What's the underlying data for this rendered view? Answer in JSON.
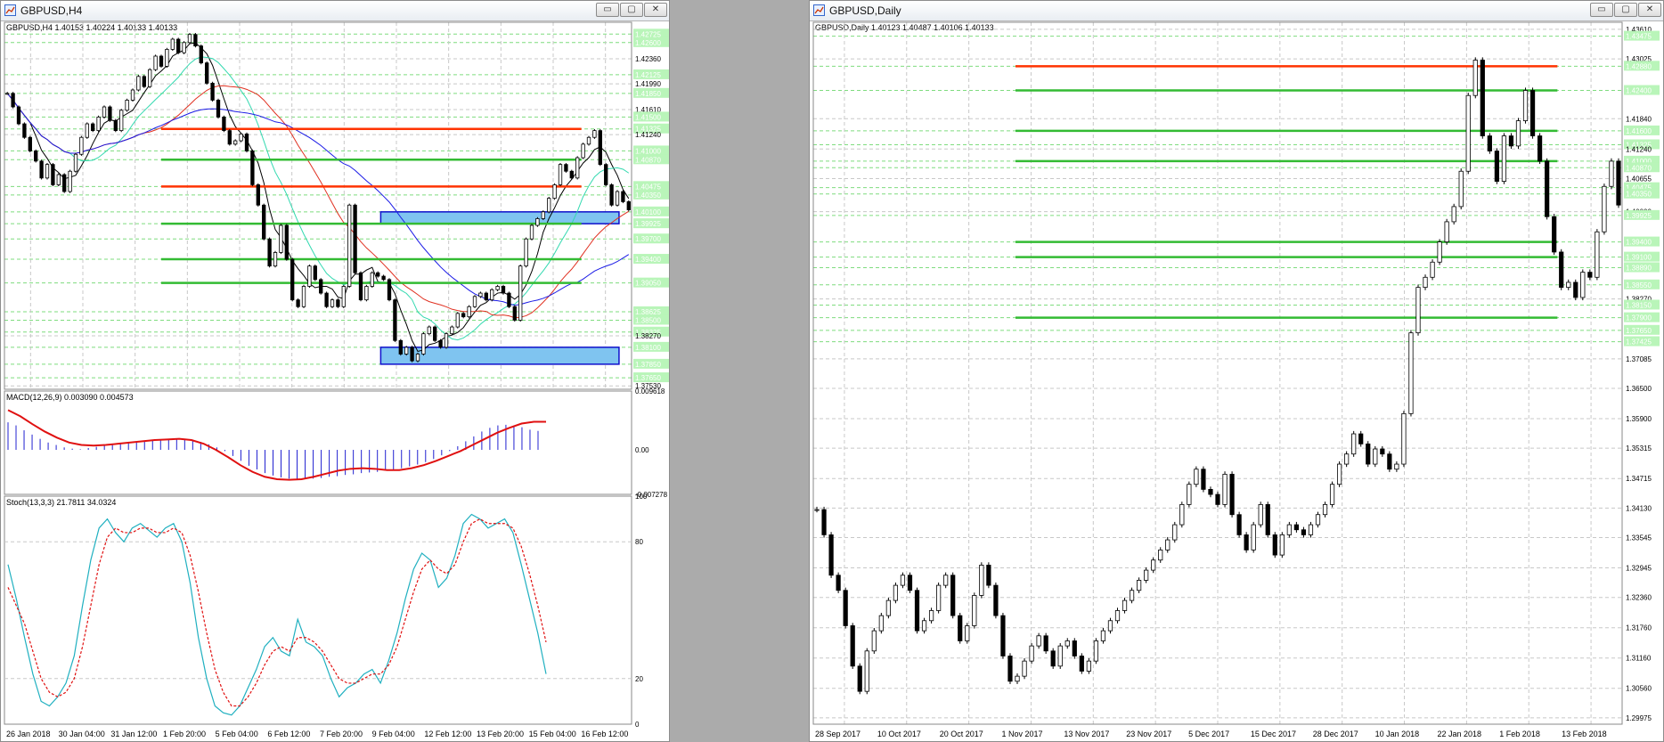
{
  "colors": {
    "grid": "#c8c8c8",
    "bull_candle": "#000000",
    "bear_candle": "#000000",
    "level_band_green": "#b9f5b9",
    "resistance_line": "#ff3300",
    "support_line": "#33bb33",
    "zone_fill": "#7fc4f0",
    "zone_border": "#1010cc",
    "ma_red": "#e03020",
    "ma_blue": "#1a1ae6",
    "ma_cyan": "#33d9b0",
    "ma_black": "#000000",
    "macd_hist": "#2020d0",
    "macd_signal": "#e01010",
    "stoch_main": "#20b0c0",
    "stoch_signal": "#e01010"
  },
  "windows": [
    {
      "title": "GBPUSD,H4",
      "icon": "chart-window-icon",
      "buttons": [
        "minimize",
        "maximize",
        "close"
      ]
    },
    {
      "title": "GBPUSD,Daily",
      "icon": "chart-window-icon",
      "buttons": [
        "minimize",
        "maximize",
        "close"
      ]
    }
  ],
  "chart_data": [
    {
      "type": "candlestick",
      "symbol_header": "GBPUSD,H4  1.40153 1.40224 1.40133 1.40133",
      "price_ticks": [
        "1.42725",
        "1.42600",
        "1.42360",
        "1.42125",
        "1.41990",
        "1.41850",
        "1.41610",
        "1.41500",
        "1.41325",
        "1.41240",
        "1.41000",
        "1.40870",
        "1.40475",
        "1.40350",
        "1.40100",
        "1.39925",
        "1.39700",
        "1.39400",
        "1.39050",
        "1.38625",
        "1.38500",
        "1.38325",
        "1.38270",
        "1.38100",
        "1.37850",
        "1.37650",
        "1.37530"
      ],
      "highlighted_ticks": [
        "1.42725",
        "1.42600",
        "1.42125",
        "1.41850",
        "1.41500",
        "1.41325",
        "1.41000",
        "1.40870",
        "1.40475",
        "1.40350",
        "1.40100",
        "1.39925",
        "1.39700",
        "1.39400",
        "1.39050",
        "1.38625",
        "1.38500",
        "1.38325",
        "1.38100",
        "1.37850",
        "1.37650"
      ],
      "ylim": [
        1.3748,
        1.429
      ],
      "x_labels": [
        "26 Jan 2018",
        "30 Jan 04:00",
        "31 Jan 12:00",
        "1 Feb 20:00",
        "5 Feb 04:00",
        "6 Feb 12:00",
        "7 Feb 20:00",
        "9 Feb 04:00",
        "12 Feb 12:00",
        "13 Feb 20:00",
        "15 Feb 04:00",
        "16 Feb 12:00"
      ],
      "candles_close": [
        1.4185,
        1.4165,
        1.414,
        1.412,
        1.41,
        1.4085,
        1.406,
        1.408,
        1.405,
        1.4065,
        1.404,
        1.407,
        1.4095,
        1.412,
        1.414,
        1.413,
        1.415,
        1.4165,
        1.4145,
        1.413,
        1.416,
        1.4175,
        1.419,
        1.421,
        1.4195,
        1.422,
        1.424,
        1.4225,
        1.425,
        1.4265,
        1.4245,
        1.426,
        1.4272,
        1.4255,
        1.423,
        1.42,
        1.4175,
        1.415,
        1.413,
        1.411,
        1.4115,
        1.4125,
        1.41,
        1.405,
        1.402,
        1.397,
        1.393,
        1.395,
        1.399,
        1.394,
        1.388,
        1.387,
        1.39,
        1.393,
        1.391,
        1.389,
        1.387,
        1.388,
        1.387,
        1.39,
        1.402,
        1.392,
        1.388,
        1.39,
        1.392,
        1.3915,
        1.391,
        1.388,
        1.382,
        1.38,
        1.381,
        1.379,
        1.38,
        1.383,
        1.384,
        1.382,
        1.381,
        1.383,
        1.384,
        1.386,
        1.3855,
        1.387,
        1.3885,
        1.389,
        1.388,
        1.3895,
        1.39,
        1.389,
        1.387,
        1.385,
        1.393,
        1.397,
        1.399,
        1.4,
        1.401,
        1.403,
        1.405,
        1.408,
        1.407,
        1.406,
        1.409,
        1.411,
        1.412,
        1.413,
        1.408,
        1.405,
        1.402,
        1.404,
        1.4025,
        1.4013
      ],
      "horizontal_levels": [
        {
          "price": 1.41325,
          "color": "resistance",
          "label": ""
        },
        {
          "price": 1.4087,
          "color": "support",
          "label": ""
        },
        {
          "price": 1.40475,
          "color": "resistance",
          "label": ""
        },
        {
          "price": 1.39925,
          "color": "support",
          "label": ""
        },
        {
          "price": 1.394,
          "color": "support",
          "label": ""
        },
        {
          "price": 1.3905,
          "color": "support",
          "label": ""
        }
      ],
      "zones": [
        {
          "from": 1.39925,
          "to": 1.401
        },
        {
          "from": 1.3785,
          "to": 1.381
        }
      ],
      "indicators": [
        {
          "type": "macd",
          "label": "MACD(12,26,9) 0.003090 0.004573",
          "ticks": [
            "0.009618",
            "0.00",
            "-0.007278"
          ],
          "ylim": [
            -0.007278,
            0.009618
          ],
          "histogram": [
            0.0045,
            0.004,
            0.0032,
            0.0025,
            0.0018,
            0.0012,
            0.0008,
            0.0004,
            0.0002,
            0.0001,
            0.0003,
            0.0005,
            0.0007,
            0.0009,
            0.0011,
            0.0013,
            0.0014,
            0.0015,
            0.0016,
            0.0017,
            0.0018,
            0.0019,
            0.0018,
            0.0016,
            0.0013,
            0.0009,
            0.0004,
            -0.0002,
            -0.001,
            -0.0018,
            -0.0026,
            -0.0032,
            -0.0038,
            -0.0042,
            -0.0045,
            -0.0047,
            -0.0048,
            -0.0048,
            -0.0047,
            -0.0046,
            -0.0044,
            -0.0043,
            -0.0041,
            -0.004,
            -0.0038,
            -0.0037,
            -0.0036,
            -0.0034,
            -0.0032,
            -0.003,
            -0.0027,
            -0.0024,
            -0.002,
            -0.0015,
            -0.0009,
            -0.0002,
            0.0006,
            0.0014,
            0.0022,
            0.003,
            0.0036,
            0.004,
            0.0041,
            0.004,
            0.0037,
            0.0033,
            0.0031
          ],
          "signal": [
            0.0065,
            0.0055,
            0.0042,
            0.003,
            0.002,
            0.0012,
            0.0008,
            0.0007,
            0.0008,
            0.001,
            0.0012,
            0.0014,
            0.0016,
            0.0017,
            0.0018,
            0.0016,
            0.001,
            0.0,
            -0.0012,
            -0.0025,
            -0.0036,
            -0.0044,
            -0.0048,
            -0.0049,
            -0.0048,
            -0.0044,
            -0.0039,
            -0.0034,
            -0.0031,
            -0.003,
            -0.0031,
            -0.0033,
            -0.0033,
            -0.003,
            -0.0025,
            -0.0018,
            -0.001,
            -0.0002,
            0.0008,
            0.0018,
            0.0028,
            0.0036,
            0.0043,
            0.0046,
            0.0046
          ]
        },
        {
          "type": "stochastic",
          "label": "Stoch(13,3,3) 21.7811 34.0324",
          "ticks": [
            "100",
            "80",
            "20",
            "0"
          ],
          "ylim": [
            0,
            100
          ],
          "main": [
            70,
            55,
            38,
            22,
            10,
            8,
            12,
            18,
            30,
            52,
            72,
            86,
            90,
            84,
            80,
            86,
            88,
            85,
            82,
            86,
            88,
            80,
            62,
            38,
            20,
            8,
            5,
            4,
            8,
            16,
            24,
            34,
            38,
            32,
            30,
            46,
            36,
            34,
            30,
            20,
            12,
            16,
            18,
            22,
            24,
            18,
            28,
            40,
            55,
            68,
            75,
            72,
            60,
            64,
            74,
            88,
            92,
            90,
            86,
            88,
            90,
            84,
            70,
            55,
            40,
            22
          ],
          "signal": [
            60,
            52,
            44,
            32,
            20,
            14,
            12,
            14,
            20,
            34,
            52,
            70,
            82,
            86,
            84,
            84,
            86,
            86,
            84,
            84,
            86,
            84,
            74,
            58,
            40,
            24,
            14,
            8,
            8,
            12,
            18,
            26,
            32,
            34,
            32,
            38,
            38,
            36,
            32,
            26,
            20,
            18,
            18,
            20,
            22,
            22,
            26,
            34,
            46,
            58,
            68,
            72,
            68,
            66,
            70,
            80,
            88,
            90,
            88,
            88,
            88,
            86,
            78,
            66,
            52,
            36
          ]
        }
      ]
    },
    {
      "type": "candlestick",
      "symbol_header": "GBPUSD,Daily  1.40123 1.40487 1.40106 1.40133",
      "price_ticks": [
        "1.43610",
        "1.43475",
        "1.43025",
        "1.42880",
        "1.42400",
        "1.41840",
        "1.41600",
        "1.41325",
        "1.41240",
        "1.41000",
        "1.40870",
        "1.40655",
        "1.40475",
        "1.40350",
        "1.40000",
        "1.39925",
        "1.39400",
        "1.39100",
        "1.38890",
        "1.38550",
        "1.38270",
        "1.38150",
        "1.37900",
        "1.37650",
        "1.37425",
        "1.37085",
        "1.36500",
        "1.35900",
        "1.35315",
        "1.34715",
        "1.34130",
        "1.33545",
        "1.32945",
        "1.32360",
        "1.31760",
        "1.31160",
        "1.30560",
        "1.29975"
      ],
      "highlighted_ticks": [
        "1.43475",
        "1.42880",
        "1.42400",
        "1.41600",
        "1.41325",
        "1.41000",
        "1.40870",
        "1.40475",
        "1.40350",
        "1.39925",
        "1.39400",
        "1.39100",
        "1.38890",
        "1.38550",
        "1.38150",
        "1.37900",
        "1.37650",
        "1.37425"
      ],
      "ylim": [
        1.2985,
        1.4375
      ],
      "x_labels": [
        "28 Sep 2017",
        "10 Oct 2017",
        "20 Oct 2017",
        "1 Nov 2017",
        "13 Nov 2017",
        "23 Nov 2017",
        "5 Dec 2017",
        "15 Dec 2017",
        "28 Dec 2017",
        "10 Jan 2018",
        "22 Jan 2018",
        "1 Feb 2018",
        "13 Feb 2018"
      ],
      "candles_close": [
        1.341,
        1.336,
        1.328,
        1.325,
        1.318,
        1.31,
        1.305,
        1.313,
        1.317,
        1.32,
        1.323,
        1.326,
        1.328,
        1.325,
        1.317,
        1.319,
        1.321,
        1.326,
        1.328,
        1.32,
        1.315,
        1.318,
        1.324,
        1.33,
        1.326,
        1.32,
        1.312,
        1.307,
        1.308,
        1.311,
        1.314,
        1.316,
        1.313,
        1.31,
        1.314,
        1.315,
        1.312,
        1.309,
        1.311,
        1.315,
        1.317,
        1.319,
        1.321,
        1.323,
        1.325,
        1.327,
        1.329,
        1.331,
        1.333,
        1.335,
        1.338,
        1.342,
        1.346,
        1.349,
        1.345,
        1.344,
        1.342,
        1.348,
        1.34,
        1.336,
        1.333,
        1.338,
        1.342,
        1.336,
        1.332,
        1.336,
        1.338,
        1.337,
        1.336,
        1.338,
        1.34,
        1.342,
        1.346,
        1.35,
        1.352,
        1.356,
        1.354,
        1.35,
        1.353,
        1.352,
        1.349,
        1.35,
        1.36,
        1.376,
        1.385,
        1.387,
        1.39,
        1.394,
        1.398,
        1.401,
        1.408,
        1.423,
        1.43,
        1.415,
        1.412,
        1.406,
        1.415,
        1.413,
        1.418,
        1.424,
        1.415,
        1.41,
        1.399,
        1.392,
        1.385,
        1.386,
        1.383,
        1.388,
        1.387,
        1.396,
        1.405,
        1.41,
        1.4013
      ],
      "horizontal_levels": [
        {
          "price": 1.4288,
          "color": "resistance",
          "label": ""
        },
        {
          "price": 1.424,
          "color": "support",
          "label": ""
        },
        {
          "price": 1.416,
          "color": "support",
          "label": ""
        },
        {
          "price": 1.41,
          "color": "support",
          "label": ""
        },
        {
          "price": 1.394,
          "color": "support",
          "label": ""
        },
        {
          "price": 1.391,
          "color": "support",
          "label": ""
        },
        {
          "price": 1.379,
          "color": "support",
          "label": ""
        }
      ],
      "zones": []
    }
  ]
}
